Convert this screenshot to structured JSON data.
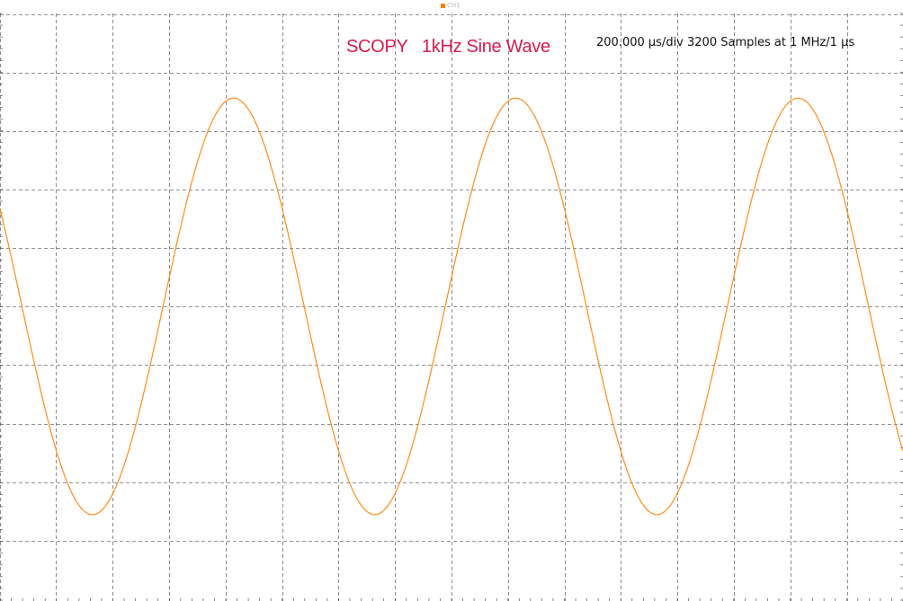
{
  "legend": {
    "label": "CH1",
    "color": "#ff7f00"
  },
  "title": "SCOPY   1kHz Sine Wave",
  "timebase_text": "200.000 µs/div 3200 Samples at 1 MHz/1 µs",
  "colors": {
    "trace": "#ff8c1a",
    "grid": "#6e6e6e",
    "title": "#d81b4f",
    "background": "#ffffff"
  },
  "chart_data": {
    "type": "line",
    "title": "SCOPY   1kHz Sine Wave",
    "series": [
      {
        "name": "CH1",
        "waveform": "sine",
        "frequency_hz": 1000,
        "amplitude_div": 3.55,
        "offset_div": 0.0,
        "phase_deg": 152
      }
    ],
    "x_divisions": 16,
    "y_divisions": 10,
    "time_per_div_us": 200,
    "samples": 3200,
    "sample_rate": "1 MHz",
    "grid": true,
    "legend_position": "top-center"
  }
}
